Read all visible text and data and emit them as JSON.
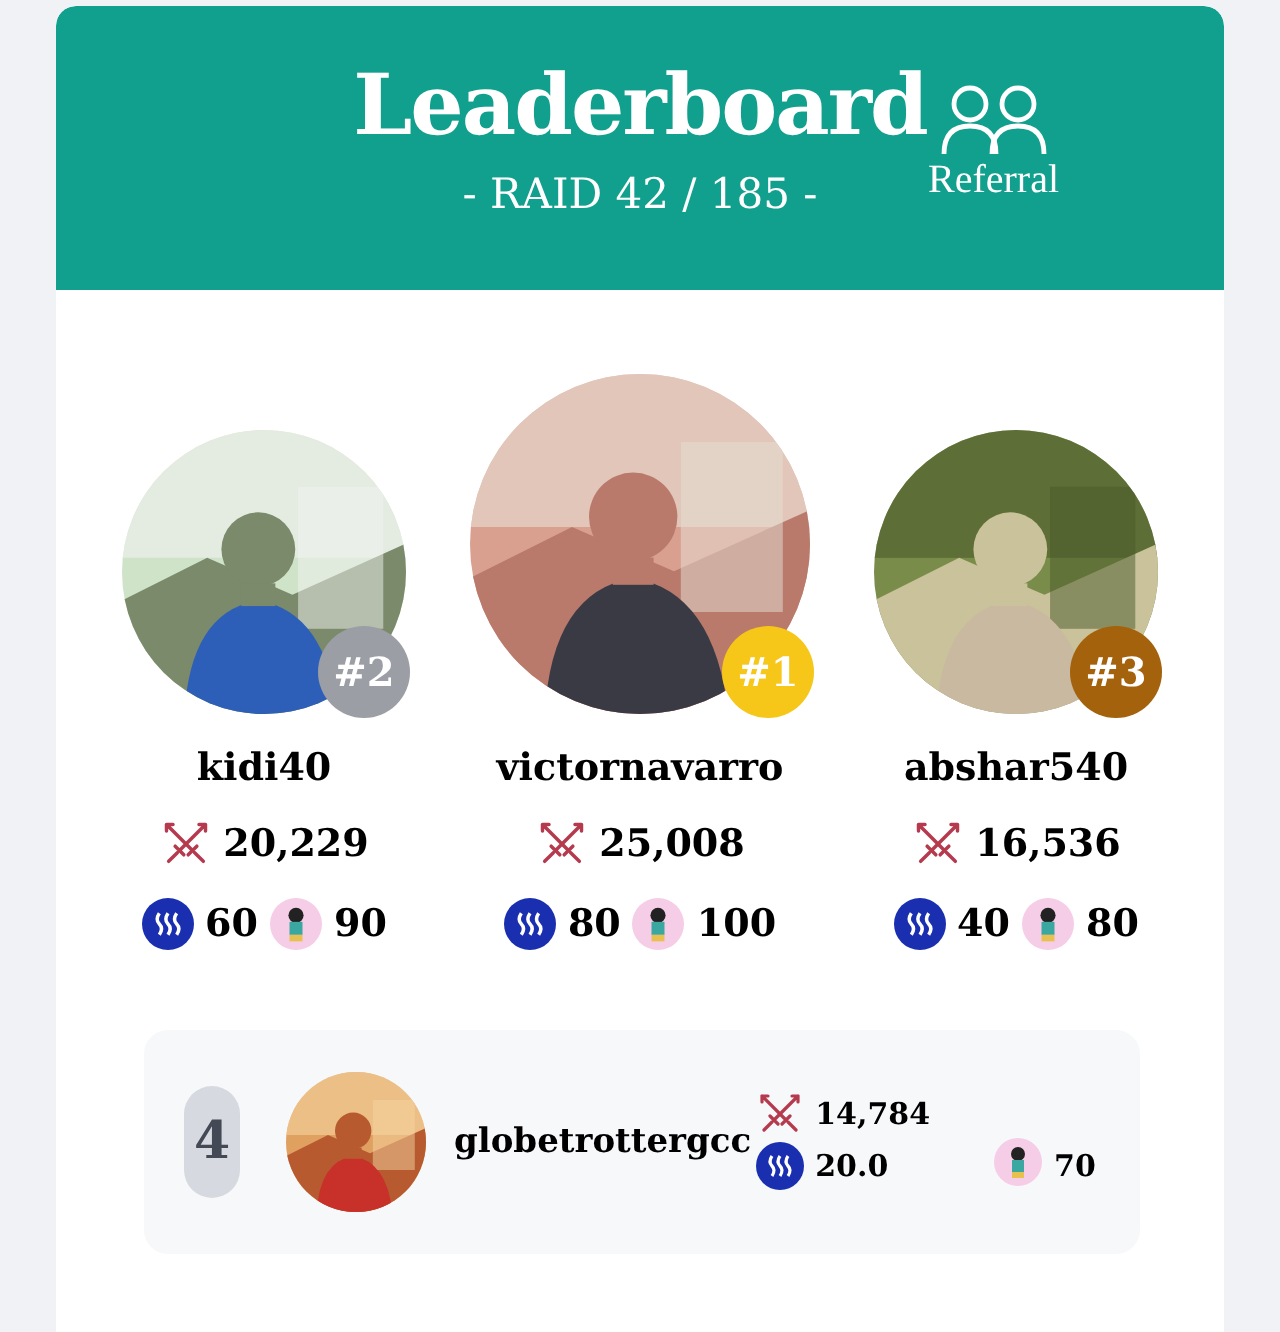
{
  "header": {
    "title": "Leaderboard",
    "subtitle": "- RAID 42 / 185 -",
    "referral": {
      "label": "Referral"
    }
  },
  "podium": [
    {
      "kind": "runner",
      "rank": "#2",
      "color": "#9b9ea4",
      "name": "kidi40",
      "score": "20,229",
      "steem": "60",
      "token": "90"
    },
    {
      "kind": "champion",
      "rank": "#1",
      "color": "#f6c619",
      "name": "victornavarro",
      "score": "25,008",
      "steem": "80",
      "token": "100"
    },
    {
      "kind": "runner",
      "rank": "#3",
      "color": "#a3620b",
      "name": "abshar540",
      "score": "16,536",
      "steem": "40",
      "token": "80"
    }
  ],
  "rows": [
    {
      "rank": "4",
      "name": "globetrottergcc",
      "score": "14,784",
      "steem": "20.0",
      "token": "70"
    }
  ]
}
